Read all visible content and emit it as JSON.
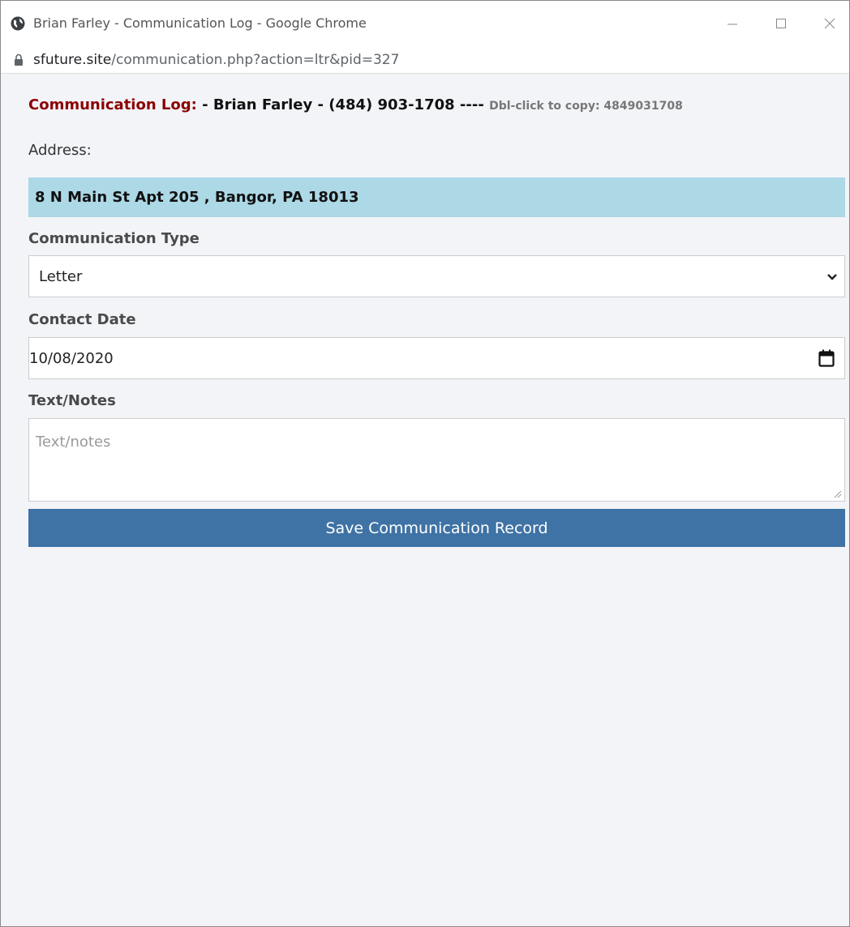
{
  "window": {
    "title": "Brian Farley - Communication Log - Google Chrome"
  },
  "address_bar": {
    "url_host": "sfuture.site",
    "url_path": "/communication.php?action=ltr&pid=327"
  },
  "header": {
    "label": "Communication Log:",
    "main": " - Brian Farley - (484) 903-1708 ---- ",
    "copy_hint": "Dbl-click to copy: 4849031708"
  },
  "address": {
    "label": "Address:",
    "value": "8 N Main St Apt 205 , Bangor, PA  18013"
  },
  "form": {
    "type_label": "Communication Type",
    "type_value": "Letter",
    "date_label": "Contact Date",
    "date_value": "10/08/2020",
    "notes_label": "Text/Notes",
    "notes_placeholder": "Text/notes",
    "save_label": "Save Communication Record"
  },
  "colors": {
    "header_label": "#8b0000",
    "address_bg": "#add8e6",
    "button_bg": "#3f73a5",
    "page_bg": "#f3f4f8"
  },
  "icons": {
    "favicon": "globe-icon",
    "security": "lock-icon",
    "select": "chevron-down-icon",
    "date": "calendar-icon",
    "textarea": "resize-handle-icon"
  }
}
